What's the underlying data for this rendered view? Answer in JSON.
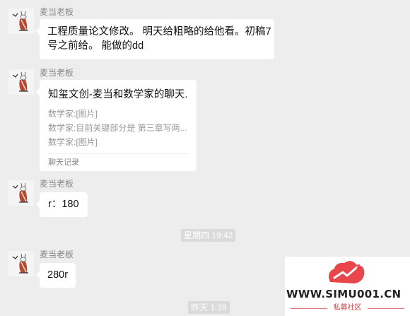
{
  "messages": [
    {
      "sender": "麦当老板",
      "line1": "工程质量论文修改。 明天给粗略的给他看。初稿7",
      "line2": "号之前给。 能做的dd"
    },
    {
      "sender": "麦当老板",
      "card_title": "知玺文创-麦当和数学家的聊天...",
      "card_lines": [
        "数学家:[图片]",
        "数学家:目前关键部分是 第三章写两...",
        "数学家:[图片]"
      ],
      "card_footer": "聊天记录"
    },
    {
      "sender": "麦当老板",
      "text": "r：180"
    },
    {
      "sender": "麦当老板",
      "text": "280r"
    }
  ],
  "timestamps": [
    "星期四 19:42",
    "昨天 1:39"
  ],
  "watermark": {
    "text": "WWW.SIMU001.CN",
    "subtext": "私募社区"
  },
  "colors": {
    "background": "#ededed",
    "bubble": "#ffffff",
    "timestamp_bg": "#dadada",
    "watermark_red": "#e8464a"
  }
}
